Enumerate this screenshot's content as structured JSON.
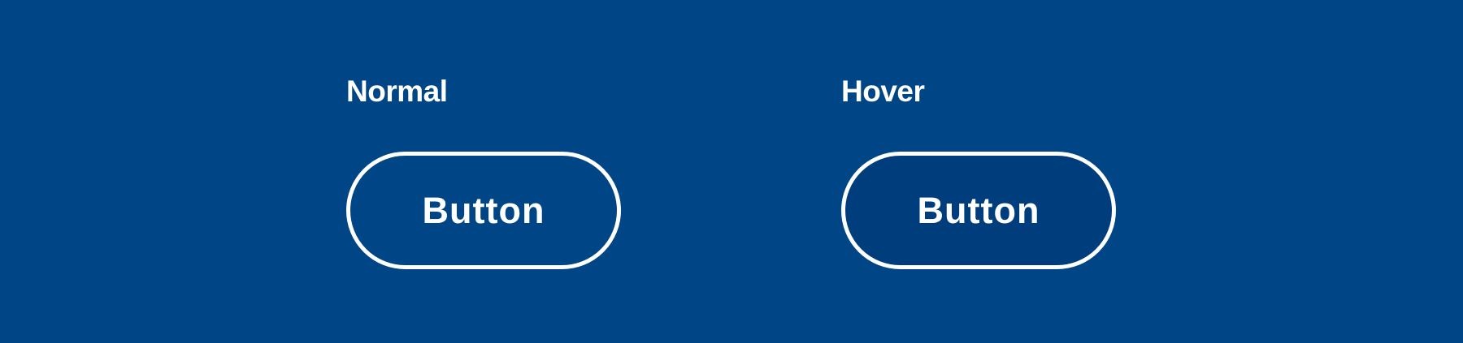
{
  "states": {
    "normal": {
      "label": "Normal",
      "button_label": "Button"
    },
    "hover": {
      "label": "Hover",
      "button_label": "Button"
    }
  },
  "colors": {
    "background": "#004687",
    "button_border": "#FFFFFF",
    "button_text": "#FFFFFF",
    "button_hover_fill": "#003D7D"
  }
}
